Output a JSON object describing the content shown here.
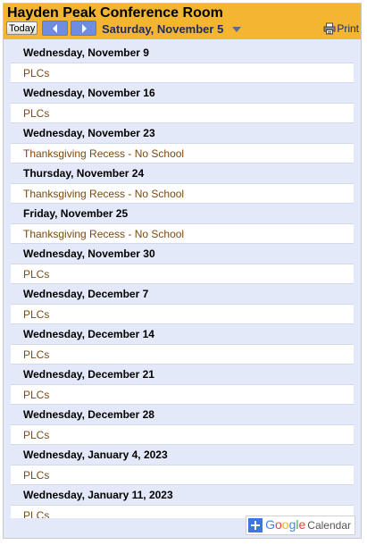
{
  "header": {
    "title": "Hayden Peak Conference Room",
    "today_label": "Today",
    "prev_icon": "chevron-left-icon",
    "next_icon": "chevron-right-icon",
    "date_label": "Saturday, November 5",
    "print_label": "Print"
  },
  "agenda": {
    "days": [
      {
        "date": "Wednesday, November 9",
        "event": "PLCs"
      },
      {
        "date": "Wednesday, November 16",
        "event": "PLCs"
      },
      {
        "date": "Wednesday, November 23",
        "event": "Thanksgiving Recess - No School"
      },
      {
        "date": "Thursday, November 24",
        "event": "Thanksgiving Recess - No School"
      },
      {
        "date": "Friday, November 25",
        "event": "Thanksgiving Recess - No School"
      },
      {
        "date": "Wednesday, November 30",
        "event": "PLCs"
      },
      {
        "date": "Wednesday, December 7",
        "event": "PLCs"
      },
      {
        "date": "Wednesday, December 14",
        "event": "PLCs"
      },
      {
        "date": "Wednesday, December 21",
        "event": "PLCs"
      },
      {
        "date": "Wednesday, December 28",
        "event": "PLCs"
      },
      {
        "date": "Wednesday, January 4, 2023",
        "event": "PLCs"
      },
      {
        "date": "Wednesday, January 11, 2023",
        "event": "PLCs"
      }
    ]
  },
  "footer": {
    "google_letters": [
      "G",
      "o",
      "o",
      "g",
      "l",
      "e"
    ],
    "google_colors": [
      "#4285f4",
      "#ea4335",
      "#fbbc05",
      "#4285f4",
      "#34a853",
      "#ea4335"
    ],
    "calendar_label": "Calendar"
  },
  "colors": {
    "header_bg": "#f4b630",
    "agenda_bg": "#e3e9f8",
    "event_text": "#7b4a11",
    "nav_button": "#6d8ee0"
  }
}
